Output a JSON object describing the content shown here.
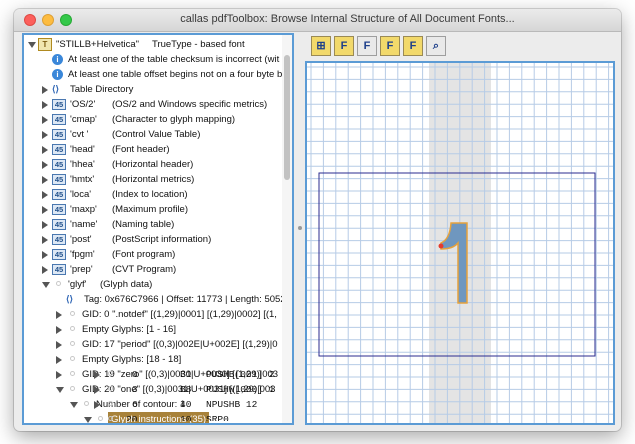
{
  "window": {
    "title": "callas pdfToolbox: Browse Internal Structure of All Document Fonts..."
  },
  "tree": {
    "root": {
      "label": "\"STILLB+Helvetica\"",
      "desc": "TrueType - based font"
    },
    "warnings": [
      "At least one of the table checksum is incorrect (wit",
      "At least one table offset begins not on a four byte b"
    ],
    "table_directory": "Table Directory",
    "tables": [
      {
        "tag": "'OS/2'",
        "desc": "(OS/2 and Windows specific metrics)"
      },
      {
        "tag": "'cmap'",
        "desc": "(Character to glyph mapping)"
      },
      {
        "tag": "'cvt '",
        "desc": "(Control Value Table)"
      },
      {
        "tag": "'head'",
        "desc": "(Font header)"
      },
      {
        "tag": "'hhea'",
        "desc": "(Horizontal header)"
      },
      {
        "tag": "'hmtx'",
        "desc": "(Horizontal metrics)"
      },
      {
        "tag": "'loca'",
        "desc": "(Index to location)"
      },
      {
        "tag": "'maxp'",
        "desc": "(Maximum profile)"
      },
      {
        "tag": "'name'",
        "desc": "(Naming table)"
      },
      {
        "tag": "'post'",
        "desc": "(PostScript information)"
      },
      {
        "tag": "'fpgm'",
        "desc": "(Font program)"
      },
      {
        "tag": "'prep'",
        "desc": "(CVT Program)"
      }
    ],
    "glyf": {
      "tag": "'glyf'",
      "desc": "(Glyph data)"
    },
    "glyf_info": "Tag: 0x676C7966 | Offset: 11773 | Length: 5052",
    "glyf_children": [
      "GID: 0  \".notdef\" [(1,29)|0001] [(1,29)|0002] [(1,",
      "Empty Glyphs: [1 - 16]",
      "GID: 17  \"period\" [(0,3)|002E|U+002E] [(1,29)|0",
      "Empty Glyphs: [18 - 18]",
      "GID: 19  \"zero\" [(0,3)|0030|U+0030] [(1,29)|003",
      "GID: 20  \"one\" [(0,3)|0031|U+0031] [(1,29)|003"
    ],
    "contours": "Number of contour: 1",
    "instructions_label": "Glyph instructions (35)",
    "instructions": [
      {
        "index": "0",
        "code": "B1",
        "op": "PUSHB[001]  2"
      },
      {
        "index": "3",
        "code": "B8",
        "op": "PUSHW[000]  1"
      },
      {
        "index": "6",
        "code": "40",
        "op": "NPUSHB 12"
      },
      {
        "index": "20",
        "code": "10",
        "op": "SRP0"
      }
    ]
  },
  "toolbar": {
    "buttons": [
      {
        "icon": "grid-icon",
        "glyph": "⊞"
      },
      {
        "icon": "font-outline-icon",
        "glyph": "F"
      },
      {
        "icon": "font-icon",
        "glyph": "F"
      },
      {
        "icon": "font-points-icon",
        "glyph": "F"
      },
      {
        "icon": "font-hinting-icon",
        "glyph": "F"
      },
      {
        "icon": "zoom-icon",
        "glyph": "⌕"
      }
    ]
  },
  "viewer": {
    "glyph_fill": "#6f97bf",
    "glyph_stroke": "#e6a23c",
    "frame_color": "#2b2b8f",
    "grid_color": "#b6cbe6",
    "band_color": "#e4e4e4",
    "point_color": "#e43b2f"
  }
}
